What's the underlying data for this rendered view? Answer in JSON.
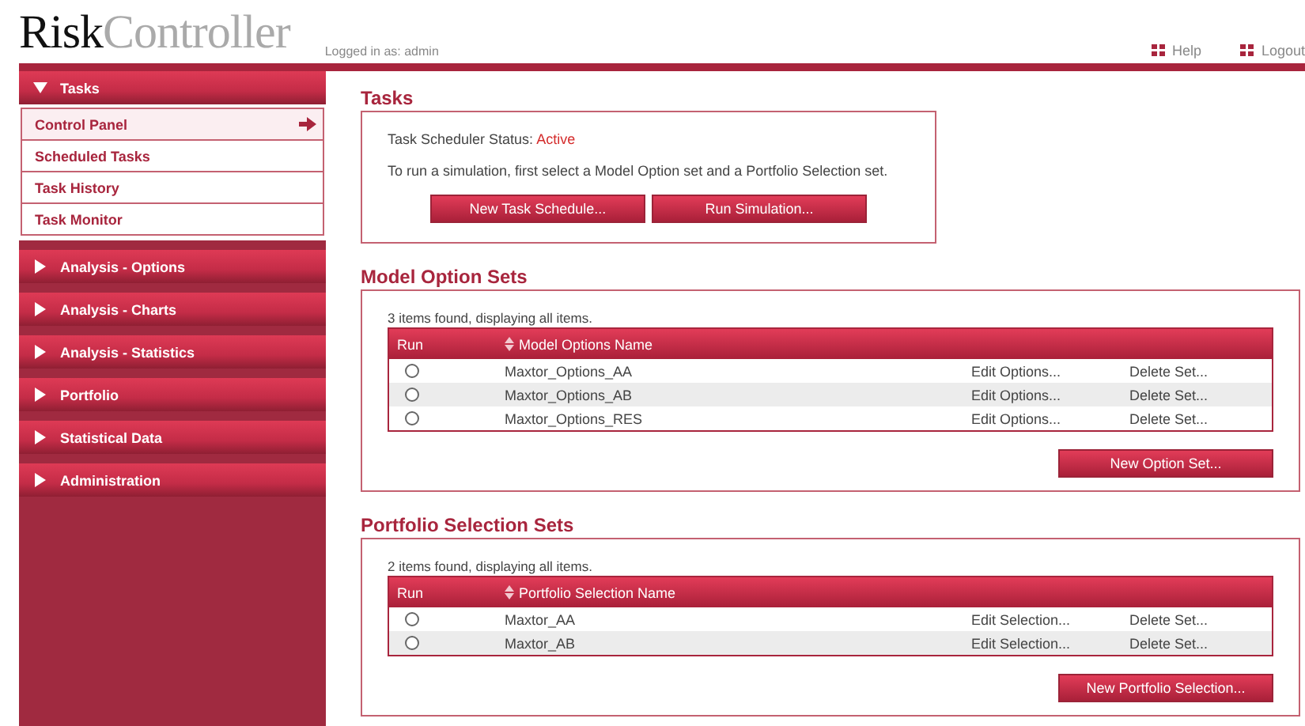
{
  "logo": {
    "bold": "Risk",
    "light": "Controller"
  },
  "login_text": "Logged in as: admin",
  "top_links": [
    {
      "label": "Help"
    },
    {
      "label": "Logout"
    }
  ],
  "sidebar": [
    {
      "label": "Tasks",
      "expanded": true,
      "children": [
        {
          "label": "Control Panel",
          "selected": true
        },
        {
          "label": "Scheduled Tasks",
          "selected": false
        },
        {
          "label": "Task History",
          "selected": false
        },
        {
          "label": "Task Monitor",
          "selected": false
        }
      ]
    },
    {
      "label": "Analysis - Options",
      "expanded": false
    },
    {
      "label": "Analysis - Charts",
      "expanded": false
    },
    {
      "label": "Analysis - Statistics",
      "expanded": false
    },
    {
      "label": "Portfolio",
      "expanded": false
    },
    {
      "label": "Statistical Data",
      "expanded": false
    },
    {
      "label": "Administration",
      "expanded": false
    }
  ],
  "tasks": {
    "title": "Tasks",
    "status_label": "Task Scheduler Status:",
    "status_value": "Active",
    "instruction": "To run a simulation, first select a Model Option set and a Portfolio Selection set.",
    "buttons": [
      "New Task Schedule...",
      "Run Simulation..."
    ]
  },
  "sets": [
    {
      "title": "Model Option Sets",
      "found": "3 items found, displaying all items.",
      "columns": [
        "Run",
        "Model Options Name"
      ],
      "rows": [
        {
          "name": "Maxtor_Options_AA",
          "edit": "Edit Options...",
          "delete": "Delete Set...",
          "selected": false
        },
        {
          "name": "Maxtor_Options_AB",
          "edit": "Edit Options...",
          "delete": "Delete Set...",
          "selected": false
        },
        {
          "name": "Maxtor_Options_RES",
          "edit": "Edit Options...",
          "delete": "Delete Set...",
          "selected": false
        }
      ],
      "button": "New Option Set..."
    },
    {
      "title": "Portfolio Selection Sets",
      "found": "2 items found, displaying all items.",
      "columns": [
        "Run",
        "Portfolio Selection Name"
      ],
      "rows": [
        {
          "name": "Maxtor_AA",
          "edit": "Edit Selection...",
          "delete": "Delete Set...",
          "selected": false
        },
        {
          "name": "Maxtor_AB",
          "edit": "Edit Selection...",
          "delete": "Delete Set...",
          "selected": false
        }
      ],
      "button": "New Portfolio Selection..."
    }
  ]
}
